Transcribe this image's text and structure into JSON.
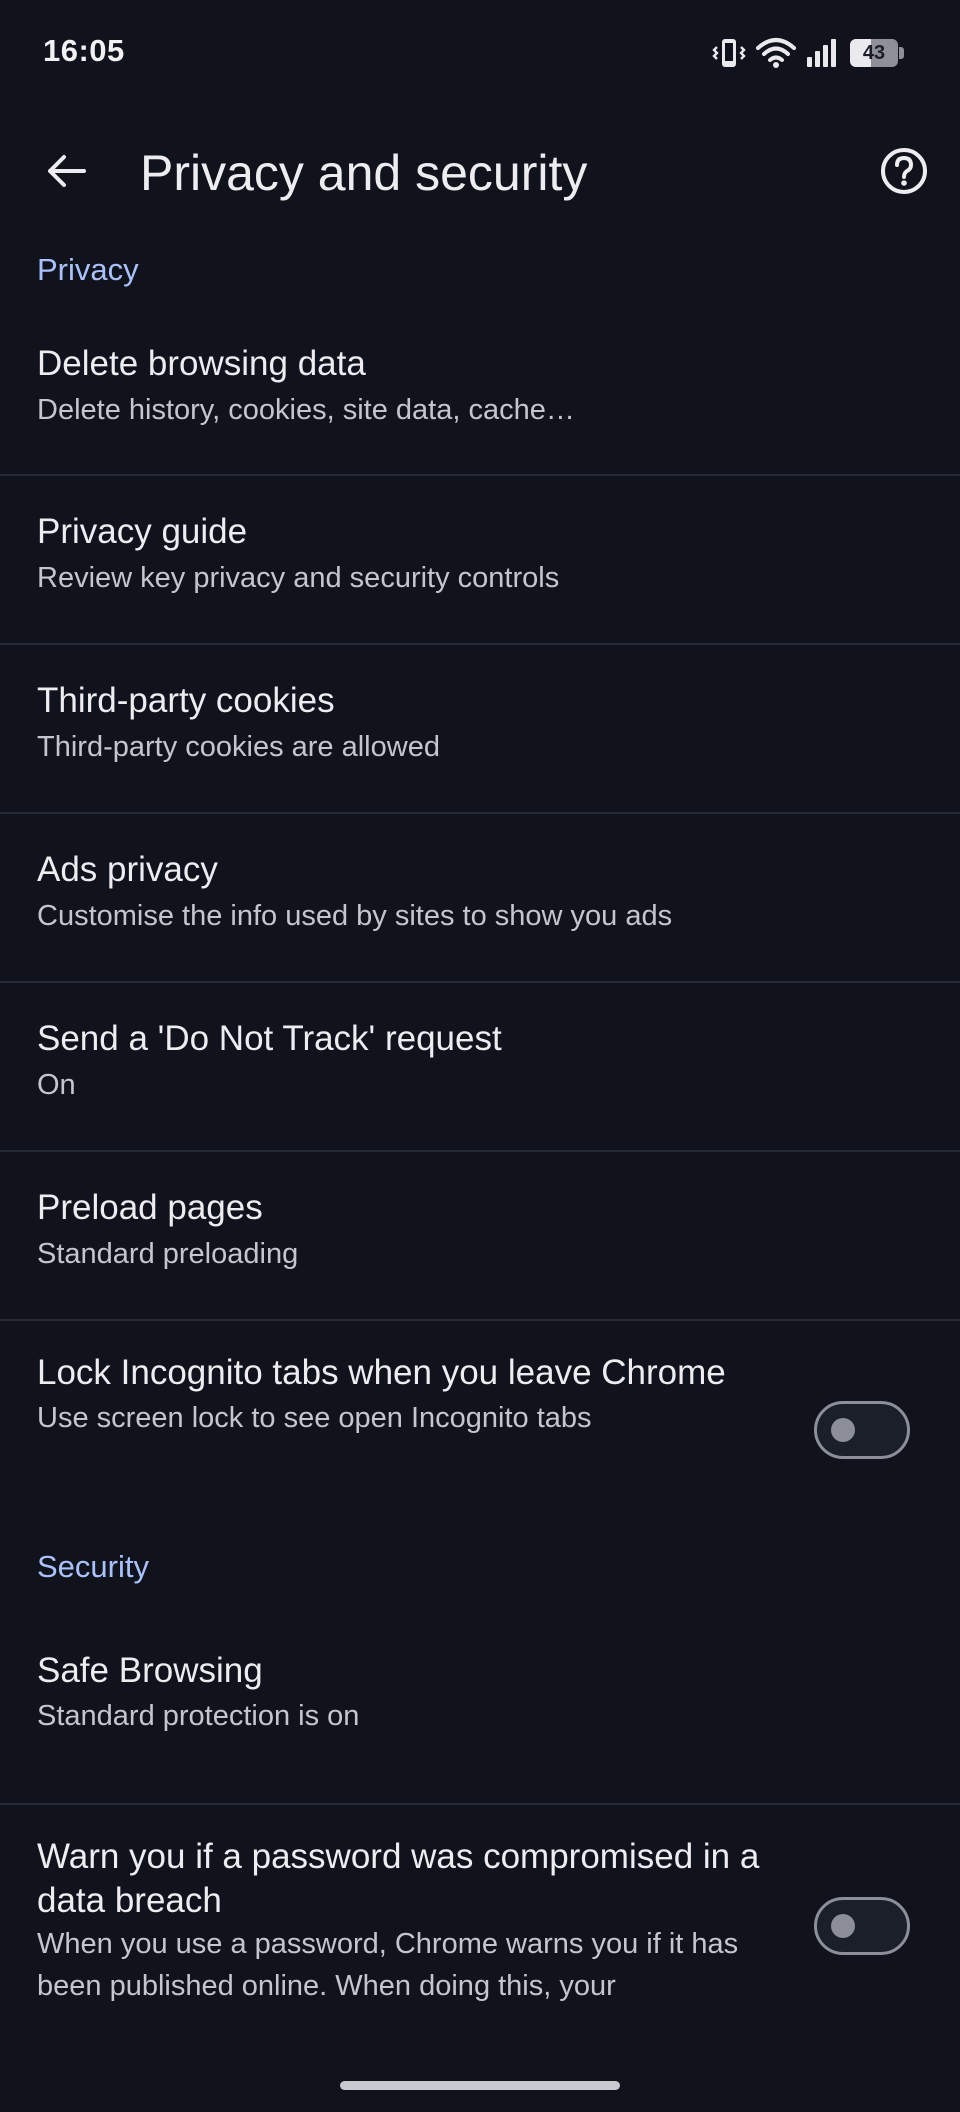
{
  "status_bar": {
    "time": "16:05",
    "battery_level": "43",
    "battery_fraction": 0.43,
    "icons": [
      "vibrate-icon",
      "wifi-icon",
      "cellular-signal-icon",
      "battery-icon"
    ]
  },
  "app_bar": {
    "title": "Privacy and security",
    "back_icon": "arrow-left-icon",
    "help_icon": "help-circle-icon"
  },
  "sections": {
    "privacy": {
      "header": "Privacy",
      "items": [
        {
          "title": "Delete browsing data",
          "subtitle": "Delete history, cookies, site data, cache…"
        },
        {
          "title": "Privacy guide",
          "subtitle": "Review key privacy and security controls"
        },
        {
          "title": "Third-party cookies",
          "subtitle": "Third-party cookies are allowed"
        },
        {
          "title": "Ads privacy",
          "subtitle": "Customise the info used by sites to show you ads"
        },
        {
          "title": "Send a 'Do Not Track' request",
          "subtitle": "On"
        },
        {
          "title": "Preload pages",
          "subtitle": "Standard preloading"
        },
        {
          "title": "Lock Incognito tabs when you leave Chrome",
          "subtitle": "Use screen lock to see open Incognito tabs",
          "toggle_on": false
        }
      ]
    },
    "security": {
      "header": "Security",
      "items": [
        {
          "title": "Safe Browsing",
          "subtitle": "Standard protection is on"
        },
        {
          "title": "Warn you if a password was compromised in a data breach",
          "subtitle": "When you use a password, Chrome warns you if it has been published online. When doing this, your",
          "toggle_on": false
        }
      ]
    }
  },
  "colors": {
    "background": "#10131c",
    "section_header": "#a9c2fb",
    "primary_text": "#ececf1",
    "secondary_text": "#c4c6ce",
    "divider": "#262a35",
    "toggle_off": "#8c8f99"
  }
}
